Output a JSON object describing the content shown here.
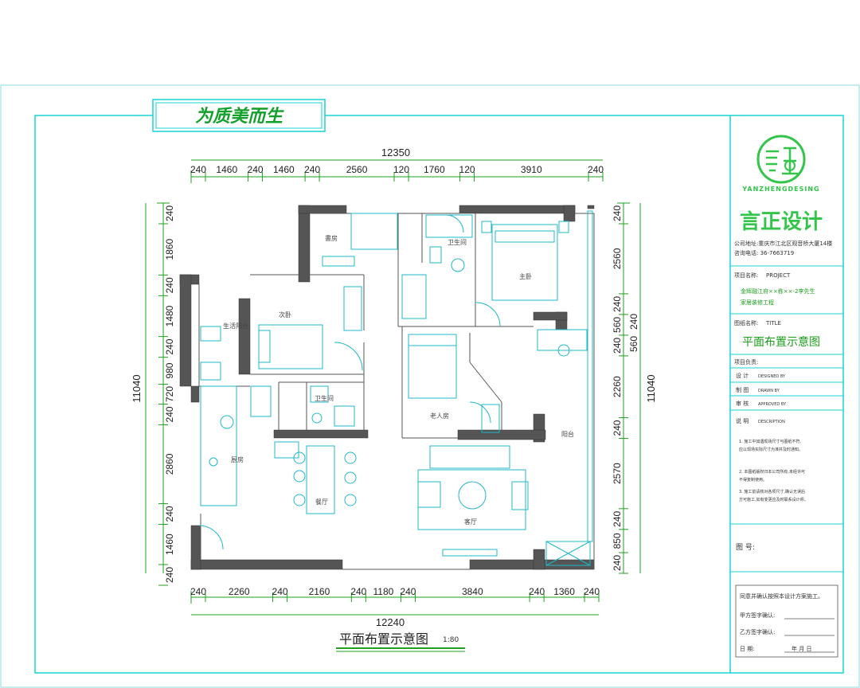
{
  "slogan": "为质美而生",
  "dims_top": {
    "total": "12350",
    "segments": [
      "240",
      "1460",
      "240",
      "1460",
      "240",
      "2560",
      "120",
      "1760",
      "120",
      "3910",
      "240"
    ]
  },
  "dims_bottom": {
    "total": "12240",
    "segments": [
      "240",
      "2260",
      "240",
      "2160",
      "240",
      "1180",
      "240",
      "3840",
      "240",
      "1360",
      "240"
    ]
  },
  "dims_left": {
    "total": "11040",
    "segments": [
      "240",
      "1860",
      "240",
      "1480",
      "240",
      "980",
      "720",
      "240",
      "2860",
      "240",
      "1460",
      "240"
    ]
  },
  "dims_right": {
    "total": "11040",
    "segments": [
      "240",
      "2560",
      "240",
      "560",
      "240",
      "2260",
      "240",
      "2570",
      "240",
      "850",
      "240"
    ]
  },
  "dims_right_extra": [
    "240",
    "560"
  ],
  "rooms": {
    "study": "書房",
    "bath1": "卫生间",
    "master": "主卧",
    "second": "次卧",
    "balcony1": "生活阳台",
    "toilet": "卫生间",
    "elder": "老人房",
    "kitchen": "厨房",
    "dining": "餐厅",
    "living": "客厅",
    "balcony2": "阳台"
  },
  "plan_title": "平面布置示意图",
  "plan_scale": "1:80",
  "title_block": {
    "brand_cn": "言正设计",
    "brand_en": "YANZHENGDESING",
    "company_address": "公司地址:重庆市江北区观音桥大厦14楼",
    "phone": "咨询电话: 36-7663719",
    "project_label": "项目名称:",
    "project_label_en": "PROJECT",
    "project_line1": "金辉融江府××栋××-2李先生",
    "project_line2": "家居装修工程",
    "drawing_label": "图纸名称:",
    "drawing_label_en": "TITLE",
    "drawing_name": "平面布置示意图",
    "leader_label": "项目负责:",
    "design_label": "设  计",
    "design_en": "DESIGNED BY",
    "draw_label": "制  图",
    "draw_en": "DRAWN BY",
    "review_label": "审  核",
    "review_en": "APPROVED BY",
    "notes_label": "说  明",
    "notes_en": "DESCRIPTION",
    "notes": [
      "1. 施工中如遇现场尺寸与图纸不符,",
      "   应以现场实际尺寸为准并及时通知。",
      "2. 本图纸版权归本公司所有,未经许可",
      "   不得复制使用。",
      "3. 施工前请核对各项尺寸,确认无误后",
      "   方可施工,如有变更应及时联系设计师。"
    ],
    "drawing_no_label": "图  号:",
    "confirm_text": "同意并确认按照本设计方案施工。",
    "party_a_label": "甲方签字确认:",
    "party_b_label": "乙方签字确认:",
    "date_label": "日      期:",
    "date_units": "年    月    日"
  }
}
